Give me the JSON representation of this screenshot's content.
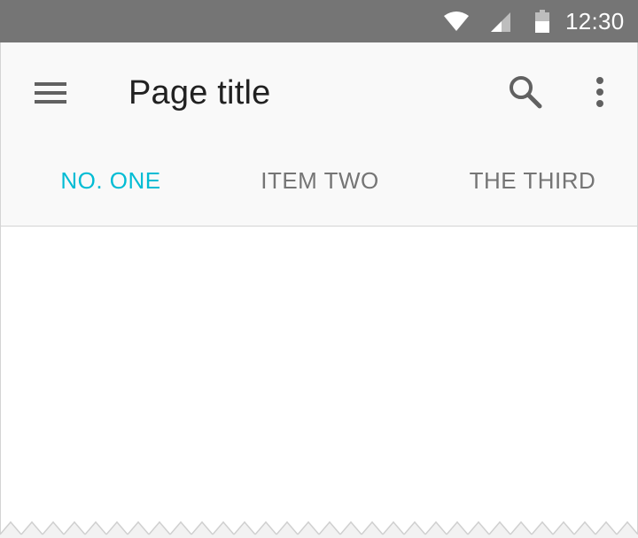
{
  "status_bar": {
    "time": "12:30",
    "wifi_icon": "wifi-icon",
    "signal_icon": "cellular-signal-icon",
    "battery_icon": "battery-icon",
    "background": "#757575"
  },
  "app_bar": {
    "title": "Page title",
    "navigation_icon": "hamburger-menu-icon",
    "action_icons": [
      "search-icon",
      "more-vert-icon"
    ],
    "background": "#f9f9f9"
  },
  "tabs": {
    "items": [
      {
        "label": "NO. ONE",
        "selected": true
      },
      {
        "label": "ITEM TWO",
        "selected": false
      },
      {
        "label": "THE THIRD",
        "selected": false
      }
    ],
    "accent_color": "#00bcd4",
    "inactive_color": "#757575"
  }
}
